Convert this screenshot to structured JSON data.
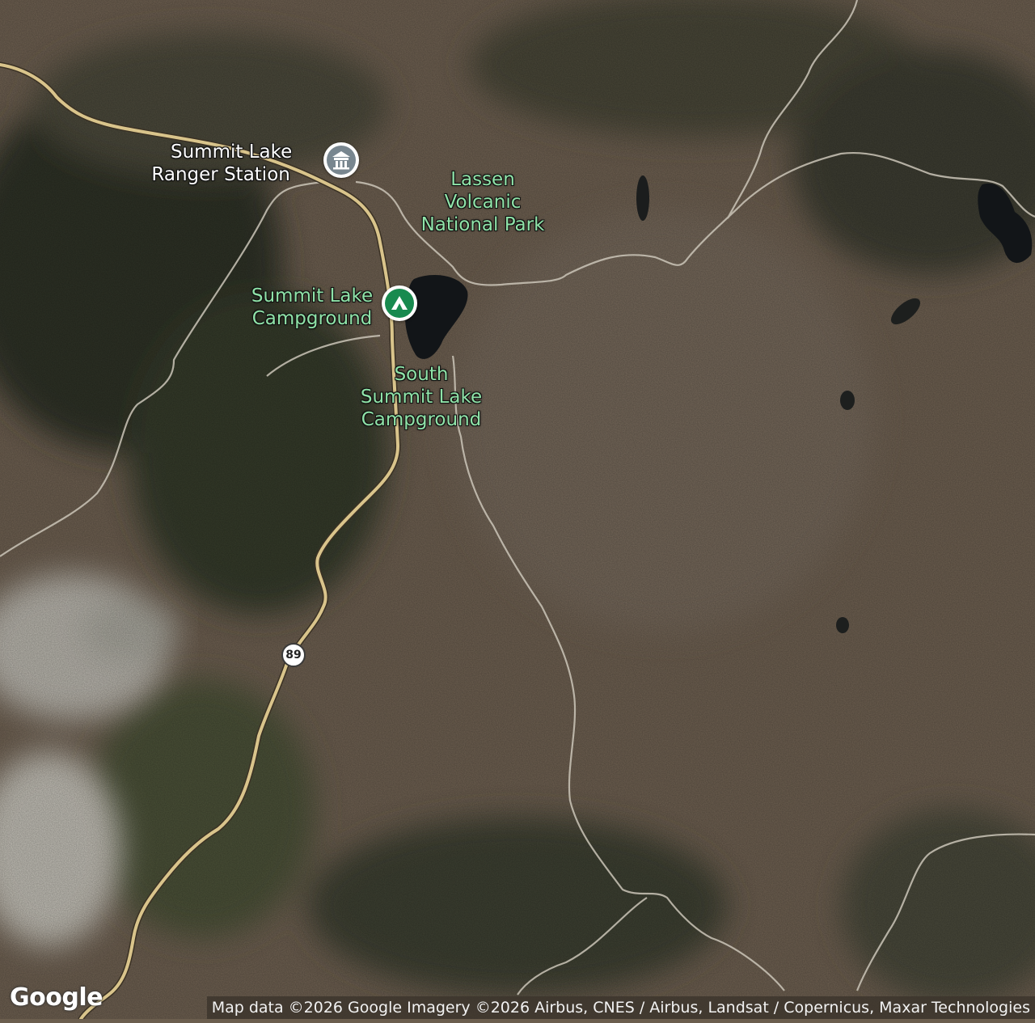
{
  "map": {
    "type": "satellite",
    "colors": {
      "terrain_base": "#6b5e4e",
      "forest_dark": "#2f3326",
      "highway": "#d8c48a",
      "trail": "#c9c3b6",
      "water": "#111417",
      "rock_light": "#c9c7c0",
      "park_label": "#8fe3a8",
      "poi_white": "#ffffff"
    }
  },
  "labels": {
    "ranger_station": [
      "Summit Lake",
      "Ranger Station"
    ],
    "national_park": [
      "Lassen",
      "Volcanic",
      "National Park"
    ],
    "summit_campground": [
      "Summit Lake",
      "Campground"
    ],
    "south_campground": [
      "South",
      "Summit Lake",
      "Campground"
    ]
  },
  "icons": {
    "ranger_station": "ranger-station-icon",
    "campground": "campground-icon"
  },
  "route_shield": "89",
  "branding": {
    "logo": "Google",
    "attribution": "Map data ©2026 Google Imagery ©2026 Airbus, CNES / Airbus, Landsat / Copernicus, Maxar Technologies"
  }
}
